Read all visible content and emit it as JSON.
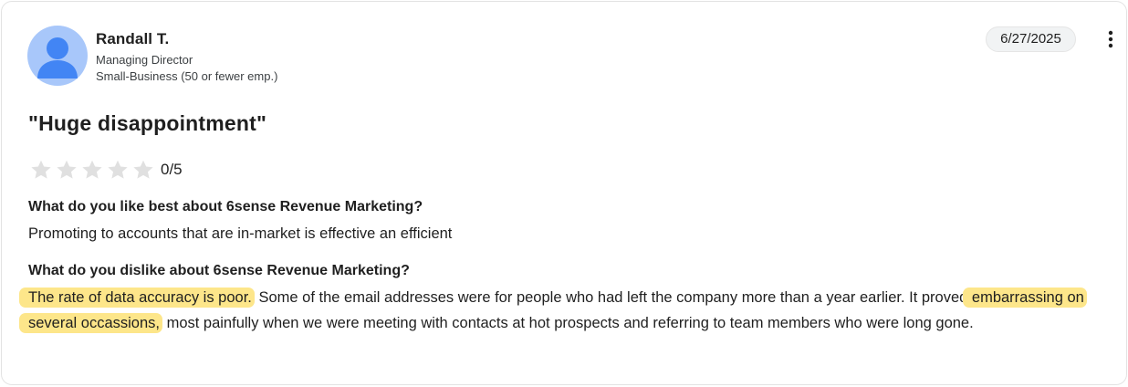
{
  "reviewer": {
    "name": "Randall T.",
    "title": "Managing Director",
    "company_size": "Small-Business (50 or fewer emp.)"
  },
  "date": "6/27/2025",
  "more_options_icon": "more-vertical-icon",
  "review": {
    "title": "\"Huge disappointment\"",
    "rating": 0,
    "rating_max": 5,
    "rating_text": "0/5"
  },
  "questions": [
    {
      "question": "What do you like best about 6sense Revenue Marketing?",
      "answer": "Promoting to accounts that are in-market is effective an efficient"
    },
    {
      "question": "What do you dislike about 6sense Revenue Marketing?",
      "answer_highlight_1": "The rate of data accuracy is poor.",
      "answer_text_1": " Some of the email addresses were for people who had left the company more than a year earlier. It proved ",
      "answer_highlight_2": "embarrassing on several occassions,",
      "answer_text_2": " most painfully when we were meeting with contacts at hot prospects and referring to team members who were long gone."
    }
  ],
  "colors": {
    "highlight": "#fde68a",
    "avatar_bg": "#a8c7fa",
    "avatar_fg": "#4285f4",
    "star_empty": "#e0e0e0"
  }
}
